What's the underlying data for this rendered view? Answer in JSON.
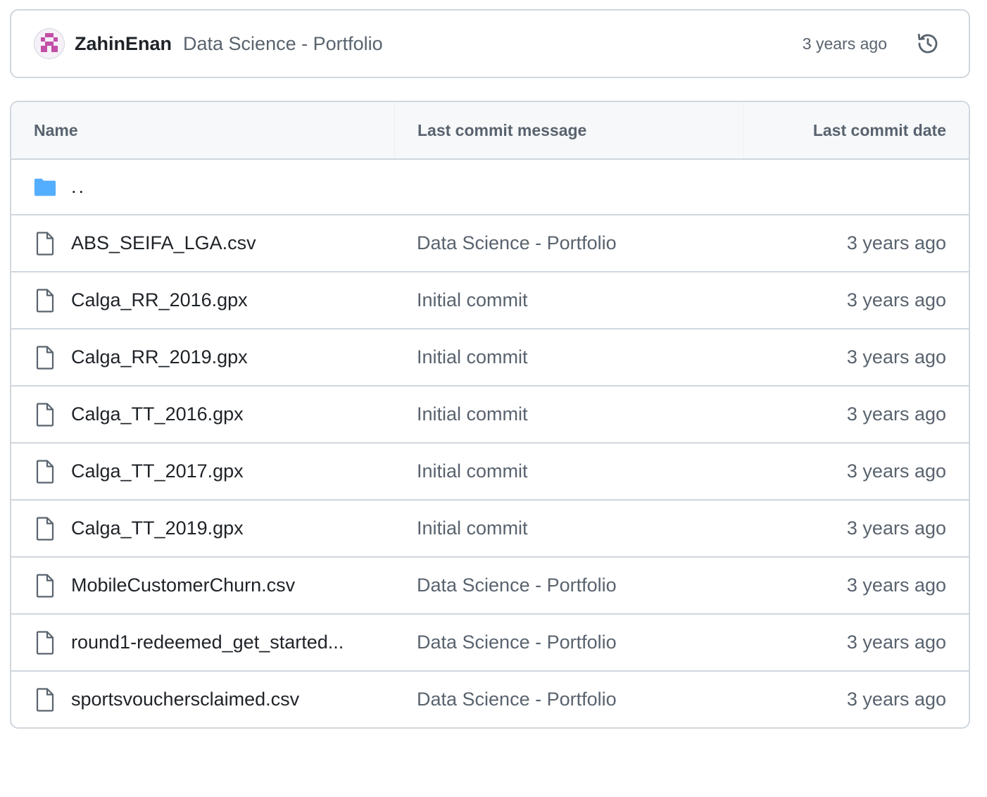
{
  "latest_commit": {
    "author": "ZahinEnan",
    "message": "Data Science - Portfolio",
    "time": "3 years ago",
    "history_icon": "history-icon"
  },
  "table": {
    "headers": {
      "name": "Name",
      "message": "Last commit message",
      "date": "Last commit date"
    },
    "parent_dir": "..",
    "colors": {
      "folder": "#54aeff",
      "border": "#d0d7de",
      "muted_text": "#59636e",
      "avatar_accent": "#c24fa8"
    },
    "files": [
      {
        "name": "ABS_SEIFA_LGA.csv",
        "message": "Data Science - Portfolio",
        "date": "3 years ago"
      },
      {
        "name": "Calga_RR_2016.gpx",
        "message": "Initial commit",
        "date": "3 years ago"
      },
      {
        "name": "Calga_RR_2019.gpx",
        "message": "Initial commit",
        "date": "3 years ago"
      },
      {
        "name": "Calga_TT_2016.gpx",
        "message": "Initial commit",
        "date": "3 years ago"
      },
      {
        "name": "Calga_TT_2017.gpx",
        "message": "Initial commit",
        "date": "3 years ago"
      },
      {
        "name": "Calga_TT_2019.gpx",
        "message": "Initial commit",
        "date": "3 years ago"
      },
      {
        "name": "MobileCustomerChurn.csv",
        "message": "Data Science - Portfolio",
        "date": "3 years ago"
      },
      {
        "name": "round1-redeemed_get_started...",
        "message": "Data Science - Portfolio",
        "date": "3 years ago"
      },
      {
        "name": "sportsvouchersclaimed.csv",
        "message": "Data Science - Portfolio",
        "date": "3 years ago"
      }
    ]
  }
}
